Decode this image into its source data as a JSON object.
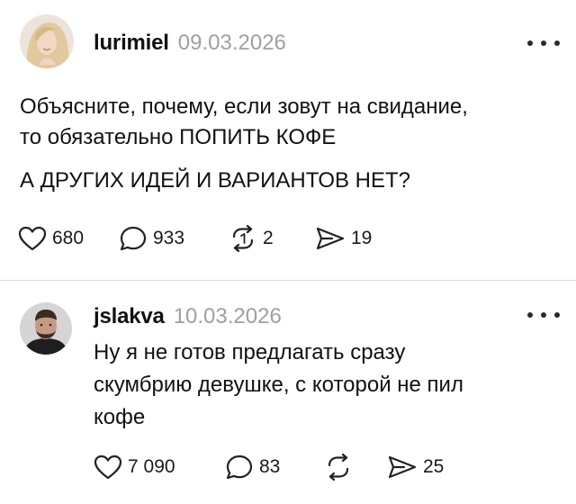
{
  "posts": [
    {
      "username": "lurimiel",
      "date": "09.03.2026",
      "lines": [
        "Объясните, почему, если зовут на свидание,",
        "то обязательно ПОПИТЬ КОФЕ"
      ],
      "paragraph2": "А ДРУГИХ ИДЕЙ И ВАРИАНТОВ НЕТ?",
      "likes": "680",
      "comments": "933",
      "reposts": "2",
      "shares": "19"
    },
    {
      "username": "jslakva",
      "date": "10.03.2026",
      "lines": [
        "Ну я не готов предлагать сразу",
        "скумбрию девушке, с которой не пил",
        "кофе"
      ],
      "likes": "7 090",
      "comments": "83",
      "shares": "25"
    }
  ],
  "icons": {
    "like": "heart-icon",
    "comment": "comment-bubble-icon",
    "repost": "repost-icon",
    "share": "send-icon",
    "more": "more-options-icon"
  },
  "colors": {
    "text": "#111111",
    "date": "#a0a0a0",
    "divider": "#d9d9d9"
  }
}
